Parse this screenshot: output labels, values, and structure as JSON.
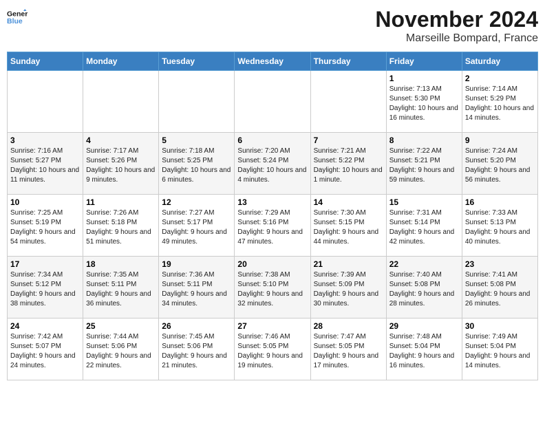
{
  "logo": {
    "text_general": "General",
    "text_blue": "Blue"
  },
  "title": "November 2024",
  "location": "Marseille Bompard, France",
  "days_of_week": [
    "Sunday",
    "Monday",
    "Tuesday",
    "Wednesday",
    "Thursday",
    "Friday",
    "Saturday"
  ],
  "weeks": [
    [
      {
        "day": "",
        "info": ""
      },
      {
        "day": "",
        "info": ""
      },
      {
        "day": "",
        "info": ""
      },
      {
        "day": "",
        "info": ""
      },
      {
        "day": "",
        "info": ""
      },
      {
        "day": "1",
        "info": "Sunrise: 7:13 AM\nSunset: 5:30 PM\nDaylight: 10 hours and 16 minutes."
      },
      {
        "day": "2",
        "info": "Sunrise: 7:14 AM\nSunset: 5:29 PM\nDaylight: 10 hours and 14 minutes."
      }
    ],
    [
      {
        "day": "3",
        "info": "Sunrise: 7:16 AM\nSunset: 5:27 PM\nDaylight: 10 hours and 11 minutes."
      },
      {
        "day": "4",
        "info": "Sunrise: 7:17 AM\nSunset: 5:26 PM\nDaylight: 10 hours and 9 minutes."
      },
      {
        "day": "5",
        "info": "Sunrise: 7:18 AM\nSunset: 5:25 PM\nDaylight: 10 hours and 6 minutes."
      },
      {
        "day": "6",
        "info": "Sunrise: 7:20 AM\nSunset: 5:24 PM\nDaylight: 10 hours and 4 minutes."
      },
      {
        "day": "7",
        "info": "Sunrise: 7:21 AM\nSunset: 5:22 PM\nDaylight: 10 hours and 1 minute."
      },
      {
        "day": "8",
        "info": "Sunrise: 7:22 AM\nSunset: 5:21 PM\nDaylight: 9 hours and 59 minutes."
      },
      {
        "day": "9",
        "info": "Sunrise: 7:24 AM\nSunset: 5:20 PM\nDaylight: 9 hours and 56 minutes."
      }
    ],
    [
      {
        "day": "10",
        "info": "Sunrise: 7:25 AM\nSunset: 5:19 PM\nDaylight: 9 hours and 54 minutes."
      },
      {
        "day": "11",
        "info": "Sunrise: 7:26 AM\nSunset: 5:18 PM\nDaylight: 9 hours and 51 minutes."
      },
      {
        "day": "12",
        "info": "Sunrise: 7:27 AM\nSunset: 5:17 PM\nDaylight: 9 hours and 49 minutes."
      },
      {
        "day": "13",
        "info": "Sunrise: 7:29 AM\nSunset: 5:16 PM\nDaylight: 9 hours and 47 minutes."
      },
      {
        "day": "14",
        "info": "Sunrise: 7:30 AM\nSunset: 5:15 PM\nDaylight: 9 hours and 44 minutes."
      },
      {
        "day": "15",
        "info": "Sunrise: 7:31 AM\nSunset: 5:14 PM\nDaylight: 9 hours and 42 minutes."
      },
      {
        "day": "16",
        "info": "Sunrise: 7:33 AM\nSunset: 5:13 PM\nDaylight: 9 hours and 40 minutes."
      }
    ],
    [
      {
        "day": "17",
        "info": "Sunrise: 7:34 AM\nSunset: 5:12 PM\nDaylight: 9 hours and 38 minutes."
      },
      {
        "day": "18",
        "info": "Sunrise: 7:35 AM\nSunset: 5:11 PM\nDaylight: 9 hours and 36 minutes."
      },
      {
        "day": "19",
        "info": "Sunrise: 7:36 AM\nSunset: 5:11 PM\nDaylight: 9 hours and 34 minutes."
      },
      {
        "day": "20",
        "info": "Sunrise: 7:38 AM\nSunset: 5:10 PM\nDaylight: 9 hours and 32 minutes."
      },
      {
        "day": "21",
        "info": "Sunrise: 7:39 AM\nSunset: 5:09 PM\nDaylight: 9 hours and 30 minutes."
      },
      {
        "day": "22",
        "info": "Sunrise: 7:40 AM\nSunset: 5:08 PM\nDaylight: 9 hours and 28 minutes."
      },
      {
        "day": "23",
        "info": "Sunrise: 7:41 AM\nSunset: 5:08 PM\nDaylight: 9 hours and 26 minutes."
      }
    ],
    [
      {
        "day": "24",
        "info": "Sunrise: 7:42 AM\nSunset: 5:07 PM\nDaylight: 9 hours and 24 minutes."
      },
      {
        "day": "25",
        "info": "Sunrise: 7:44 AM\nSunset: 5:06 PM\nDaylight: 9 hours and 22 minutes."
      },
      {
        "day": "26",
        "info": "Sunrise: 7:45 AM\nSunset: 5:06 PM\nDaylight: 9 hours and 21 minutes."
      },
      {
        "day": "27",
        "info": "Sunrise: 7:46 AM\nSunset: 5:05 PM\nDaylight: 9 hours and 19 minutes."
      },
      {
        "day": "28",
        "info": "Sunrise: 7:47 AM\nSunset: 5:05 PM\nDaylight: 9 hours and 17 minutes."
      },
      {
        "day": "29",
        "info": "Sunrise: 7:48 AM\nSunset: 5:04 PM\nDaylight: 9 hours and 16 minutes."
      },
      {
        "day": "30",
        "info": "Sunrise: 7:49 AM\nSunset: 5:04 PM\nDaylight: 9 hours and 14 minutes."
      }
    ]
  ]
}
